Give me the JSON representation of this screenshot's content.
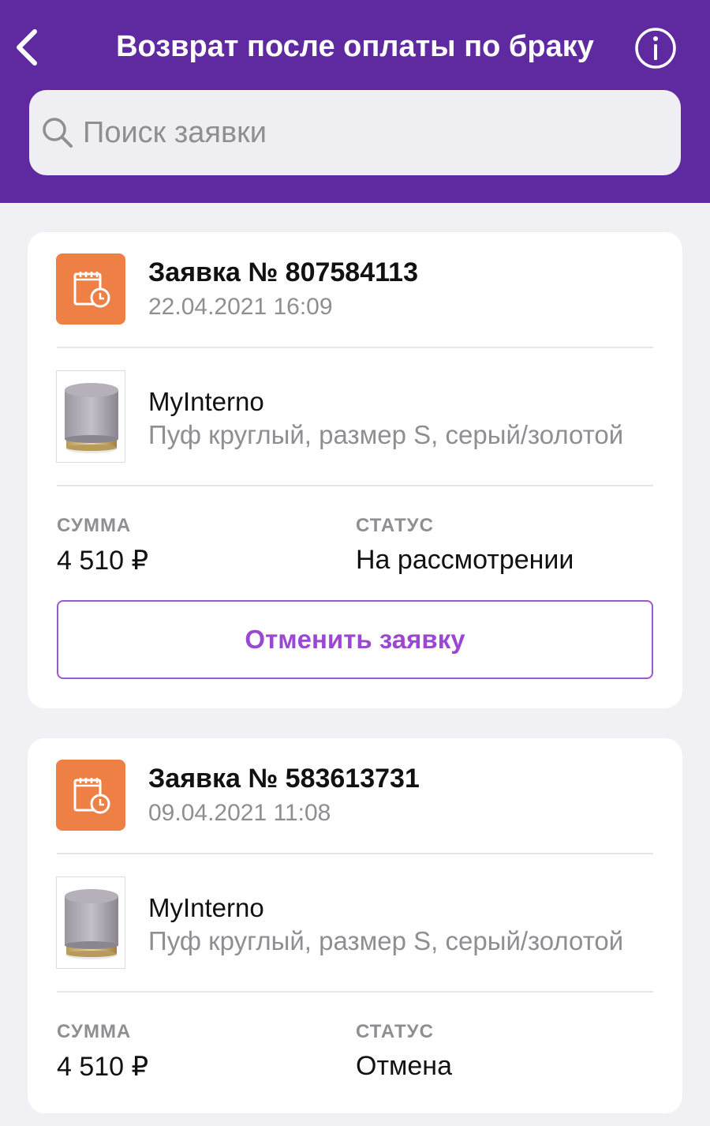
{
  "header": {
    "title": "Возврат после оплаты по браку",
    "back_icon": "chevron-left-icon",
    "info_icon": "info-icon"
  },
  "search": {
    "placeholder": "Поиск заявки",
    "value": ""
  },
  "colors": {
    "header_bg": "#5f2aa0",
    "request_icon_bg": "#ee7f45",
    "cancel_accent": "#9b48d0",
    "page_bg": "#f0f0f5"
  },
  "requests": [
    {
      "title": "Заявка № 807584113",
      "date": "22.04.2021 16:09",
      "brand": "MyInterno",
      "description": "Пуф круглый, размер S, серый/золотой",
      "amount_label": "СУММА",
      "amount": "4 510 ₽",
      "status_label": "СТАТУС",
      "status": "На рассмотрении",
      "cancel_label": "Отменить заявку"
    },
    {
      "title": "Заявка № 583613731",
      "date": "09.04.2021 11:08",
      "brand": "MyInterno",
      "description": "Пуф круглый, размер S, серый/золотой",
      "amount_label": "СУММА",
      "amount": "4 510 ₽",
      "status_label": "СТАТУС",
      "status": "Отмена"
    }
  ]
}
